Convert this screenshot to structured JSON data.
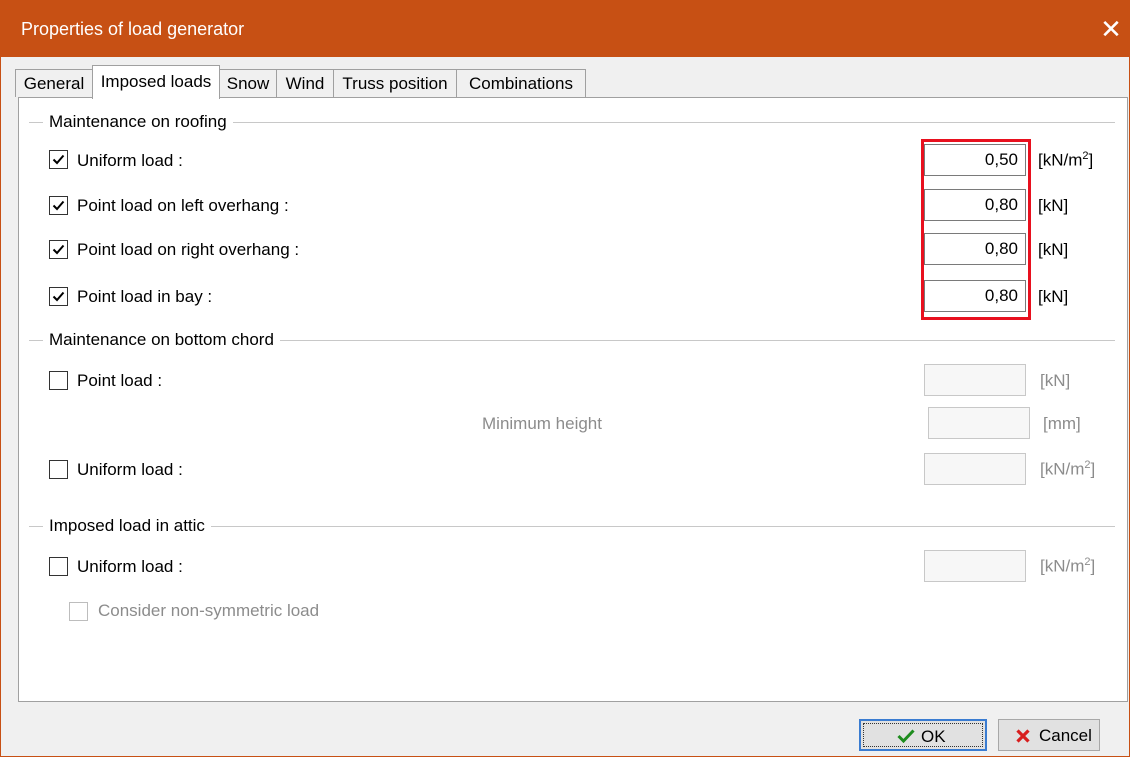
{
  "window": {
    "title": "Properties of load generator",
    "close_icon": "close-icon"
  },
  "tabs": [
    {
      "label": "General",
      "active": false
    },
    {
      "label": "Imposed loads",
      "active": true
    },
    {
      "label": "Snow",
      "active": false
    },
    {
      "label": "Wind",
      "active": false
    },
    {
      "label": "Truss position",
      "active": false
    },
    {
      "label": "Combinations",
      "active": false
    }
  ],
  "roofing": {
    "title": "Maintenance on roofing",
    "rows": [
      {
        "label": "Uniform load :",
        "checked": true,
        "value": "0,50",
        "unit_base": "[kN/m",
        "unit_sup": "2",
        "unit_end": "]"
      },
      {
        "label": "Point load on left overhang :",
        "checked": true,
        "value": "0,80",
        "unit": "[kN]"
      },
      {
        "label": "Point load on right overhang :",
        "checked": true,
        "value": "0,80",
        "unit": "[kN]"
      },
      {
        "label": "Point load in bay :",
        "checked": true,
        "value": "0,80",
        "unit": "[kN]"
      }
    ]
  },
  "bottom_chord": {
    "title": "Maintenance on bottom chord",
    "point_load": {
      "label": "Point load :",
      "checked": false,
      "value": "",
      "unit": "[kN]"
    },
    "min_height": {
      "label": "Minimum height",
      "value": "",
      "unit": "[mm]"
    },
    "uniform_load": {
      "label": "Uniform load :",
      "checked": false,
      "value": "",
      "unit_base": "[kN/m",
      "unit_sup": "2",
      "unit_end": "]"
    }
  },
  "attic": {
    "title": "Imposed load in attic",
    "uniform_load": {
      "label": "Uniform load :",
      "checked": false,
      "value": "",
      "unit_base": "[kN/m",
      "unit_sup": "2",
      "unit_end": "]"
    },
    "non_symmetric": {
      "label": "Consider non-symmetric load",
      "checked": false
    }
  },
  "buttons": {
    "ok": "OK",
    "cancel": "Cancel"
  },
  "colors": {
    "titlebar": "#c75014",
    "highlight": "#e8101e",
    "ok_icon": "#1e8c1e",
    "cancel_icon": "#d81e1e"
  }
}
